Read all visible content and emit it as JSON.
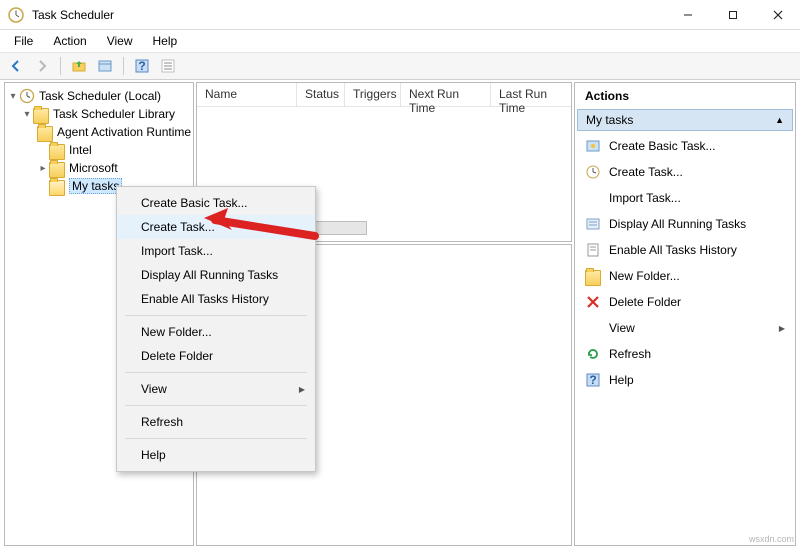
{
  "window": {
    "title": "Task Scheduler"
  },
  "menus": {
    "file": "File",
    "action": "Action",
    "view": "View",
    "help": "Help"
  },
  "tree": {
    "root": "Task Scheduler (Local)",
    "library": "Task Scheduler Library",
    "items": [
      "Agent Activation Runtime",
      "Intel",
      "Microsoft",
      "My tasks"
    ]
  },
  "columns": {
    "name": "Name",
    "status": "Status",
    "triggers": "Triggers",
    "next": "Next Run Time",
    "last": "Last Run Time"
  },
  "context_menu": {
    "create_basic": "Create Basic Task...",
    "create_task": "Create Task...",
    "import": "Import Task...",
    "display_running": "Display All Running Tasks",
    "enable_history": "Enable All Tasks History",
    "new_folder": "New Folder...",
    "delete_folder": "Delete Folder",
    "view": "View",
    "refresh": "Refresh",
    "help": "Help"
  },
  "actions": {
    "header": "Actions",
    "section": "My tasks",
    "items": {
      "create_basic": "Create Basic Task...",
      "create_task": "Create Task...",
      "import": "Import Task...",
      "display_running": "Display All Running Tasks",
      "enable_history": "Enable All Tasks History",
      "new_folder": "New Folder...",
      "delete_folder": "Delete Folder",
      "view": "View",
      "refresh": "Refresh",
      "help": "Help"
    }
  },
  "watermark": "wsxdn.com"
}
